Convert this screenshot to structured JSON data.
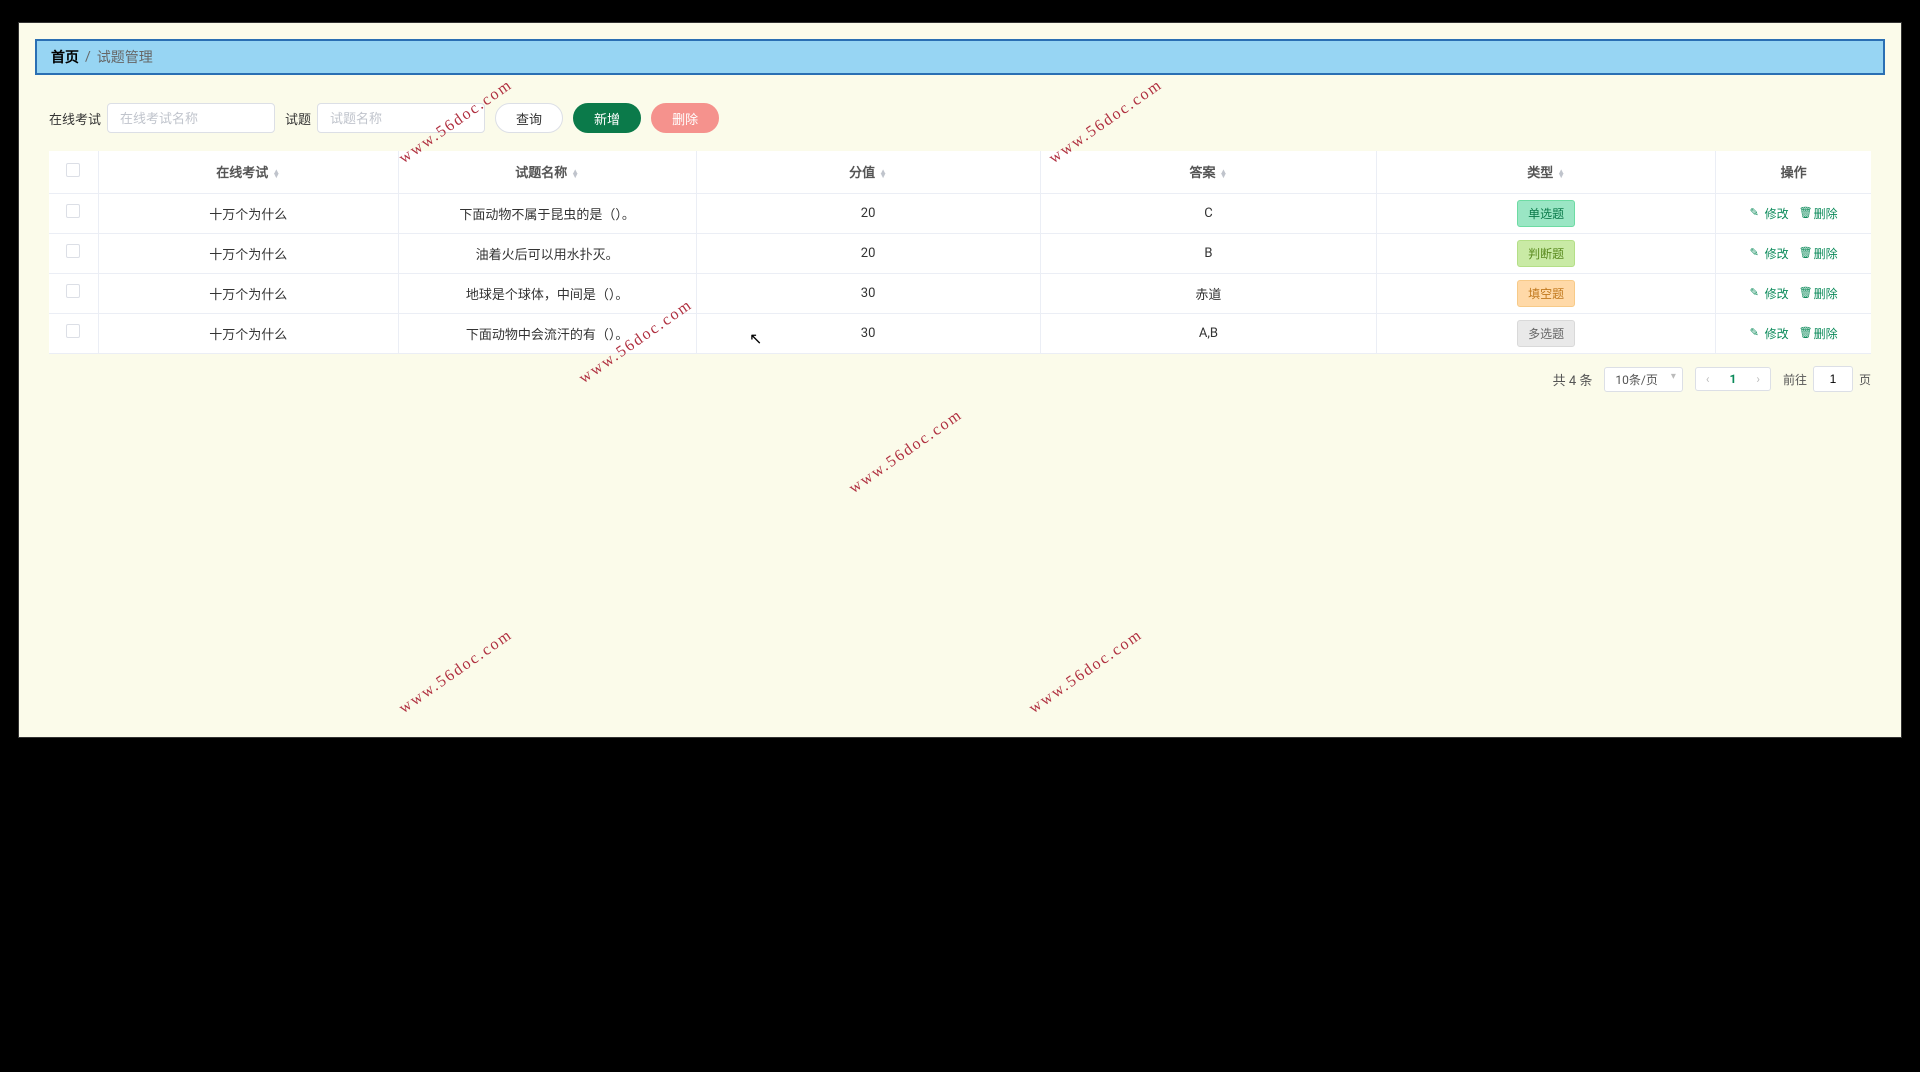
{
  "breadcrumb": {
    "home": "首页",
    "current": "试题管理"
  },
  "toolbar": {
    "exam_label": "在线考试",
    "exam_placeholder": "在线考试名称",
    "question_label": "试题",
    "question_placeholder": "试题名称",
    "search_btn": "查询",
    "add_btn": "新增",
    "delete_btn": "删除"
  },
  "columns": {
    "exam": "在线考试",
    "qname": "试题名称",
    "score": "分值",
    "answer": "答案",
    "type": "类型",
    "ops": "操作"
  },
  "type_tags": {
    "single": "单选题",
    "judge": "判断题",
    "fill": "填空题",
    "multi": "多选题"
  },
  "ops": {
    "edit": "修改",
    "delete": "删除"
  },
  "rows": [
    {
      "exam": "十万个为什么",
      "qname": "下面动物不属于昆虫的是（）。",
      "score": "20",
      "answer": "C",
      "type_key": "single"
    },
    {
      "exam": "十万个为什么",
      "qname": "油着火后可以用水扑灭。",
      "score": "20",
      "answer": "B",
      "type_key": "judge"
    },
    {
      "exam": "十万个为什么",
      "qname": "地球是个球体，中间是（）。",
      "score": "30",
      "answer": "赤道",
      "type_key": "fill"
    },
    {
      "exam": "十万个为什么",
      "qname": "下面动物中会流汗的有（）。",
      "score": "30",
      "answer": "A,B",
      "type_key": "multi"
    }
  ],
  "pagination": {
    "total_text": "共 4 条",
    "page_size": "10条/页",
    "current": "1",
    "jump_prefix": "前往",
    "jump_value": "1",
    "jump_suffix": "页"
  },
  "watermark": "www.56doc.com"
}
